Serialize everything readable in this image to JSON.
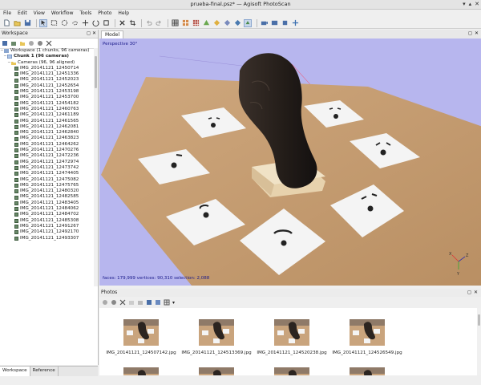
{
  "window": {
    "title": "prueba-final.psz* — Agisoft PhotoScan"
  },
  "menu": [
    "File",
    "Edit",
    "View",
    "Workflow",
    "Tools",
    "Photo",
    "Help"
  ],
  "workspace": {
    "title": "Workspace",
    "root_label": "Workspace (1 chunks, 96 cameras)",
    "chunk_label": "Chunk 1 (96 cameras)",
    "cameras_label": "Cameras (96, 96 aligned)",
    "cameras": [
      "IMG_20141121_12450714",
      "IMG_20141121_12451336",
      "IMG_20141121_12452023",
      "IMG_20141121_12452654",
      "IMG_20141121_12453198",
      "IMG_20141121_12453700",
      "IMG_20141121_12454182",
      "IMG_20141121_12460763",
      "IMG_20141121_12461189",
      "IMG_20141121_12461565",
      "IMG_20141121_12462081",
      "IMG_20141121_12462840",
      "IMG_20141121_12463823",
      "IMG_20141121_12464262",
      "IMG_20141121_12470276",
      "IMG_20141121_12472236",
      "IMG_20141121_12472974",
      "IMG_20141121_12473742",
      "IMG_20141121_12474405",
      "IMG_20141121_12475082",
      "IMG_20141121_12475765",
      "IMG_20141121_12480320",
      "IMG_20141121_12482585",
      "IMG_20141121_12483405",
      "IMG_20141121_12484062",
      "IMG_20141121_12484702",
      "IMG_20141121_12485308",
      "IMG_20141121_12491267",
      "IMG_20141121_12492170",
      "IMG_20141121_12493307"
    ]
  },
  "bottom_tabs": [
    "Workspace",
    "Reference"
  ],
  "model": {
    "tab_label": "Model",
    "projection_label": "Perspective 30°",
    "stats": "faces: 179,999 vertices: 90,310 selection: 2,088"
  },
  "photos": {
    "title": "Photos",
    "thumbnails": [
      "IMG_20141121_124507142.jpg",
      "IMG_20141121_124513369.jpg",
      "IMG_20141121_124520238.jpg",
      "IMG_20141121_124526549.jpg"
    ]
  },
  "colors": {
    "viewport_bg": "#b7b6ee",
    "board": "#c9a47d",
    "model": "#2b2420",
    "accent": "#8aa6cf"
  }
}
